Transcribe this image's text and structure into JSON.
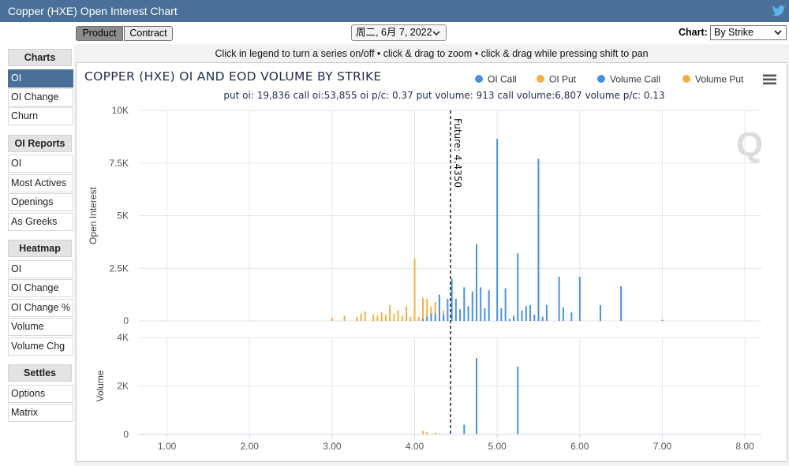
{
  "window": {
    "title": "Copper (HXE) Open Interest Chart",
    "share_icon": "twitter-icon"
  },
  "toolbar": {
    "product_label": "Product",
    "contract_label": "Contract",
    "date_value": "周二, 6月 7, 2022",
    "date_icon": "chevron-down-icon",
    "chart_label": "Chart:",
    "chart_value": "By Strike"
  },
  "sidebar": {
    "sections": [
      {
        "title": "Charts",
        "items": [
          "OI",
          "OI Change",
          "Churn"
        ]
      },
      {
        "title": "OI Reports",
        "items": [
          "OI",
          "Most Actives",
          "Openings",
          "As Greeks"
        ]
      },
      {
        "title": "Heatmap",
        "items": [
          "OI",
          "OI Change",
          "OI Change %",
          "Volume",
          "Volume Chg"
        ]
      },
      {
        "title": "Settles",
        "items": [
          "Options",
          "Matrix"
        ]
      }
    ],
    "active": "Charts/OI"
  },
  "hint": "Click in legend to turn a series on/off • click & drag to zoom • click & drag while pressing shift to pan",
  "colors": {
    "call": "#4a90e2",
    "put": "#f5b041",
    "titlebar": "#4a7099"
  },
  "chart_data": {
    "type": "bar",
    "title": "COPPER (HXE) OI AND EOD VOLUME BY STRIKE",
    "subtitle": "put oi: 19,836 call oi:53,855 oi p/c: 0.37 put volume: 913 call volume:6,807 volume p/c: 0.13",
    "legend": [
      "OI Call",
      "OI Put",
      "Volume Call",
      "Volume Put"
    ],
    "legend_position": "top-right",
    "future_label": "Future: 4.4350",
    "future_value": 4.435,
    "x": {
      "min": 0.65,
      "max": 8.2,
      "ticks": [
        1,
        2,
        3,
        4,
        5,
        6,
        7,
        8
      ],
      "tick_labels": [
        "1.00",
        "2.00",
        "3.00",
        "4.00",
        "5.00",
        "6.00",
        "7.00",
        "8.00"
      ]
    },
    "panels": [
      {
        "ylabel": "Open Interest",
        "ylim": [
          0,
          10000
        ],
        "yticks": [
          0,
          2500,
          5000,
          7500,
          10000
        ],
        "ytick_labels": [
          "0",
          "2.5K",
          "5K",
          "7.5K",
          "10K"
        ],
        "series": [
          {
            "name": "OI Put",
            "color": "#f5b041",
            "points": [
              [
                3.0,
                150
              ],
              [
                3.15,
                250
              ],
              [
                3.3,
                200
              ],
              [
                3.35,
                350
              ],
              [
                3.4,
                450
              ],
              [
                3.5,
                300
              ],
              [
                3.55,
                250
              ],
              [
                3.6,
                400
              ],
              [
                3.65,
                300
              ],
              [
                3.7,
                750
              ],
              [
                3.75,
                350
              ],
              [
                3.8,
                500
              ],
              [
                3.85,
                250
              ],
              [
                3.9,
                700
              ],
              [
                3.95,
                200
              ],
              [
                4.0,
                2950
              ],
              [
                4.05,
                200
              ],
              [
                4.1,
                1100
              ],
              [
                4.15,
                1050
              ],
              [
                4.2,
                700
              ],
              [
                4.25,
                900
              ],
              [
                4.3,
                150
              ],
              [
                4.35,
                500
              ],
              [
                4.4,
                150
              ],
              [
                4.5,
                100
              ],
              [
                4.6,
                100
              ],
              [
                4.65,
                200
              ],
              [
                4.7,
                150
              ],
              [
                4.75,
                100
              ]
            ]
          },
          {
            "name": "OI Call",
            "color": "#4a90e2",
            "points": [
              [
                4.1,
                100
              ],
              [
                4.15,
                200
              ],
              [
                4.2,
                350
              ],
              [
                4.25,
                350
              ],
              [
                4.3,
                1250
              ],
              [
                4.35,
                300
              ],
              [
                4.4,
                1050
              ],
              [
                4.45,
                2000
              ],
              [
                4.5,
                1050
              ],
              [
                4.55,
                550
              ],
              [
                4.6,
                1600
              ],
              [
                4.65,
                700
              ],
              [
                4.7,
                1400
              ],
              [
                4.75,
                3650
              ],
              [
                4.8,
                1600
              ],
              [
                4.85,
                600
              ],
              [
                4.9,
                1450
              ],
              [
                5.0,
                8650
              ],
              [
                5.05,
                600
              ],
              [
                5.1,
                1550
              ],
              [
                5.15,
                100
              ],
              [
                5.2,
                250
              ],
              [
                5.25,
                3200
              ],
              [
                5.3,
                500
              ],
              [
                5.35,
                700
              ],
              [
                5.4,
                750
              ],
              [
                5.45,
                300
              ],
              [
                5.5,
                7700
              ],
              [
                5.55,
                200
              ],
              [
                5.6,
                750
              ],
              [
                5.75,
                2100
              ],
              [
                5.8,
                650
              ],
              [
                5.9,
                400
              ],
              [
                6.0,
                2100
              ],
              [
                6.25,
                750
              ],
              [
                6.5,
                1650
              ],
              [
                7.0,
                50
              ]
            ]
          }
        ]
      },
      {
        "ylabel": "Volume",
        "ylim": [
          0,
          4000
        ],
        "yticks": [
          0,
          2000,
          4000
        ],
        "ytick_labels": [
          "0",
          "2K",
          "4K"
        ],
        "series": [
          {
            "name": "Volume Put",
            "color": "#f5b041",
            "points": [
              [
                4.1,
                150
              ],
              [
                4.15,
                100
              ],
              [
                4.25,
                80
              ],
              [
                4.3,
                50
              ]
            ]
          },
          {
            "name": "Volume Call",
            "color": "#4a90e2",
            "points": [
              [
                4.6,
                400
              ],
              [
                4.75,
                3150
              ],
              [
                5.25,
                2800
              ]
            ]
          }
        ]
      }
    ]
  }
}
